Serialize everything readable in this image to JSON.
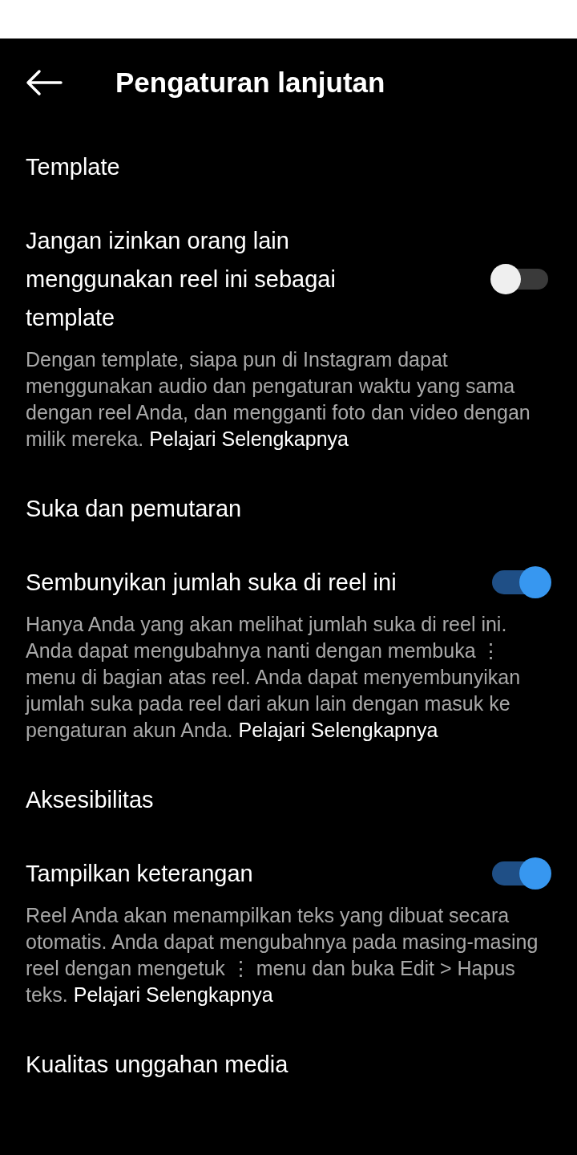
{
  "header": {
    "title": "Pengaturan lanjutan"
  },
  "sections": [
    {
      "heading": "Template",
      "settings": [
        {
          "label": "Jangan izinkan orang lain menggunakan reel ini sebagai template",
          "on": false,
          "description": "Dengan template, siapa pun di Instagram dapat menggunakan audio dan pengaturan waktu yang sama dengan reel Anda, dan mengganti foto dan video dengan milik mereka.",
          "link": "Pelajari Selengkapnya"
        }
      ]
    },
    {
      "heading": "Suka dan pemutaran",
      "settings": [
        {
          "label": "Sembunyikan jumlah suka di reel ini",
          "on": true,
          "description": "Hanya Anda yang akan melihat jumlah suka di reel ini. Anda dapat mengubahnya nanti dengan membuka ⋮ menu di bagian atas reel. Anda dapat menyembunyikan jumlah suka pada reel dari akun lain dengan masuk ke pengaturan akun Anda.",
          "link": "Pelajari Selengkapnya"
        }
      ]
    },
    {
      "heading": "Aksesibilitas",
      "settings": [
        {
          "label": "Tampilkan keterangan",
          "on": true,
          "description": "Reel Anda akan menampilkan teks yang dibuat secara otomatis. Anda dapat mengubahnya pada masing-masing reel dengan mengetuk ⋮ menu dan buka Edit > Hapus teks.",
          "link": "Pelajari Selengkapnya"
        }
      ]
    },
    {
      "heading": "Kualitas unggahan media"
    }
  ]
}
